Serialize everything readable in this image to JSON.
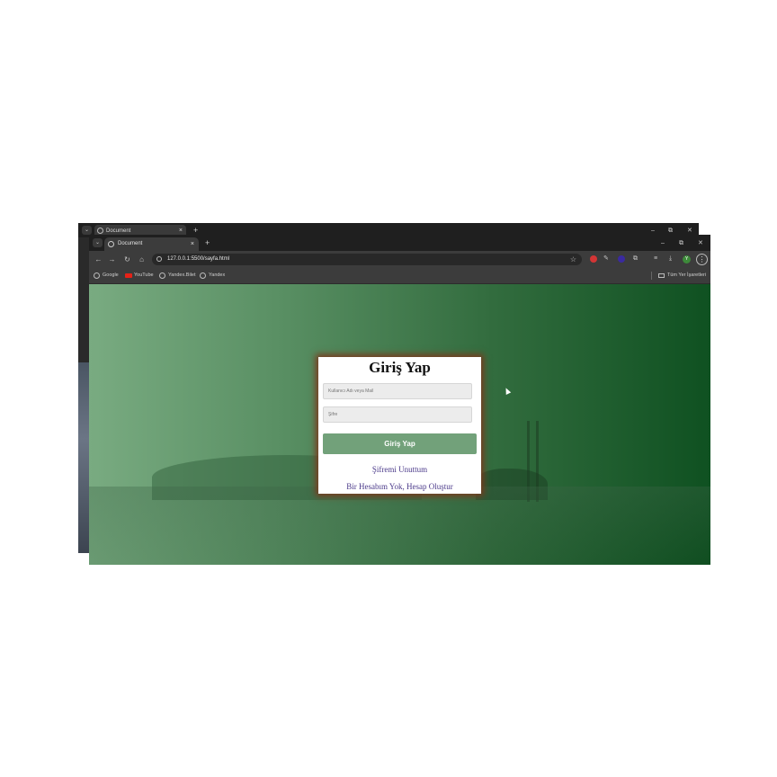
{
  "back_window": {
    "tab_title": "Document",
    "tab_close": "×",
    "new_tab": "+",
    "controls": {
      "minimize": "–",
      "restore": "⧉",
      "close": "✕"
    }
  },
  "front_window": {
    "tab_list": "⌄",
    "tab_title": "Document",
    "tab_close": "×",
    "new_tab": "+",
    "controls": {
      "minimize": "–",
      "restore": "⧉",
      "close": "✕"
    },
    "nav": {
      "back": "←",
      "forward": "→",
      "reload": "↻",
      "home": "⌂"
    },
    "address": "127.0.0.1:5500/sayfa.html",
    "bookmark_star": "☆",
    "avatar_letter": "Y",
    "menu": "⋮",
    "bookmarks": [
      "Google",
      "YouTube",
      "Yandex.Bilet",
      "Yandex"
    ],
    "all_bookmarks": "Tüm Yer İşaretleri"
  },
  "login": {
    "title": "Giriş Yap",
    "username_placeholder": "Kullanıcı Adı veya Mail",
    "password_placeholder": "Şifre",
    "submit_label": "Giriş Yap",
    "forgot_link": "Şifremi Unuttum",
    "register_link": "Bir Hesabım Yok, Hesap Oluştur"
  },
  "colors": {
    "card_glow": "#7a3a1e",
    "button": "#72a17a",
    "background_left": "#79ab81",
    "background_right": "#0f5121"
  }
}
